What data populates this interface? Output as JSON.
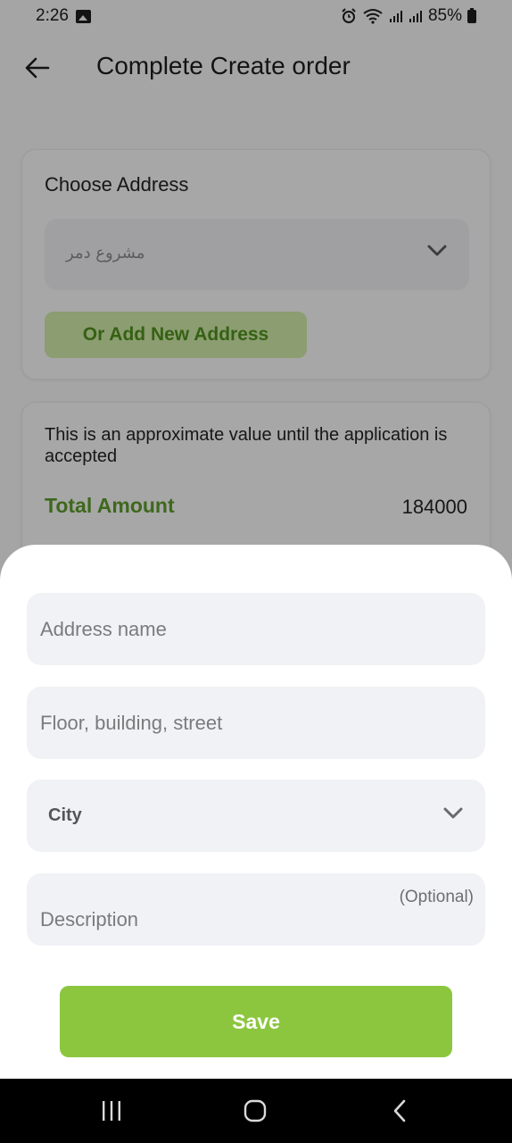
{
  "status_bar": {
    "time": "2:26",
    "battery": "85%"
  },
  "app_bar": {
    "title": "Complete Create order"
  },
  "address_card": {
    "label": "Choose Address",
    "selected_address": "مشروع دمر",
    "add_new_label": "Or Add New Address"
  },
  "total_card": {
    "note": "This is an approximate value until the application is accepted",
    "total_label": "Total Amount",
    "total_value": "184000"
  },
  "sheet": {
    "address_name_placeholder": "Address name",
    "street_placeholder": "Floor, building, street",
    "city_label": "City",
    "description_placeholder": "Description",
    "optional_hint": "(Optional)",
    "save_label": "Save"
  },
  "colors": {
    "accent_green": "#8cc63f",
    "label_green": "#5c9a2a",
    "field_bg": "#f1f2f6"
  },
  "icons": {
    "back": "arrow-left-icon",
    "chevron": "chevron-down-icon",
    "gallery": "gallery-icon",
    "alarm": "alarm-icon",
    "wifi": "wifi-icon",
    "signal": "signal-icon",
    "battery": "battery-icon"
  }
}
